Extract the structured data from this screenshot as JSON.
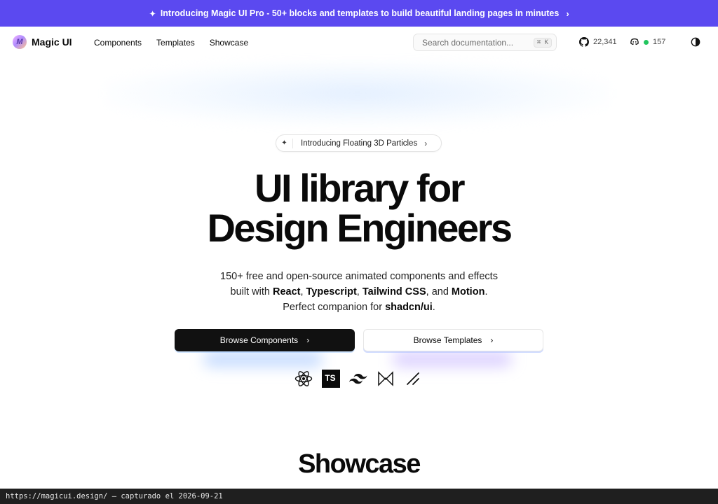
{
  "banner": {
    "icon": "sparkles-icon",
    "text": "Introducing Magic UI Pro - 50+ blocks and templates to build beautiful landing pages in minutes",
    "chevron": "›"
  },
  "header": {
    "logo_text": "Magic UI",
    "logo_letter": "M",
    "nav": [
      {
        "label": "Components"
      },
      {
        "label": "Templates"
      },
      {
        "label": "Showcase"
      }
    ],
    "search": {
      "placeholder": "Search documentation...",
      "shortcut": "⌘ K"
    },
    "github_stars": "22,341",
    "discord_count": "157",
    "status_color": "#22c55e"
  },
  "announcement_pill": {
    "text": "Introducing Floating 3D Particles",
    "chevron": "›"
  },
  "hero": {
    "title_line1": "UI library for",
    "title_line2": "Design Engineers",
    "sub_line1": "150+ free and open-source animated components and effects",
    "sub_line2_prefix": "built with ",
    "tech_react": "React",
    "sep1": ", ",
    "tech_ts": "Typescript",
    "sep2": ", ",
    "tech_tailwind": "Tailwind CSS",
    "sep3": ", and ",
    "tech_motion": "Motion",
    "end_period": ".",
    "sub_line3_prefix": "Perfect companion for ",
    "tech_shadcn": "shadcn/ui",
    "end_period2": "."
  },
  "buttons": {
    "primary_label": "Browse Components",
    "secondary_label": "Browse Templates",
    "chevron": "›"
  },
  "tech_icons": [
    {
      "name": "react-icon"
    },
    {
      "name": "typescript-icon",
      "label": "TS"
    },
    {
      "name": "tailwind-icon"
    },
    {
      "name": "motion-icon"
    },
    {
      "name": "shadcn-icon"
    }
  ],
  "showcase_heading": "Showcase",
  "status_bar_text": "https://magicui.design/ — capturado el 2026-09-21",
  "colors": {
    "banner_bg": "#5b49f0",
    "primary_btn_bg": "#111111",
    "text": "#0a0a0a"
  }
}
